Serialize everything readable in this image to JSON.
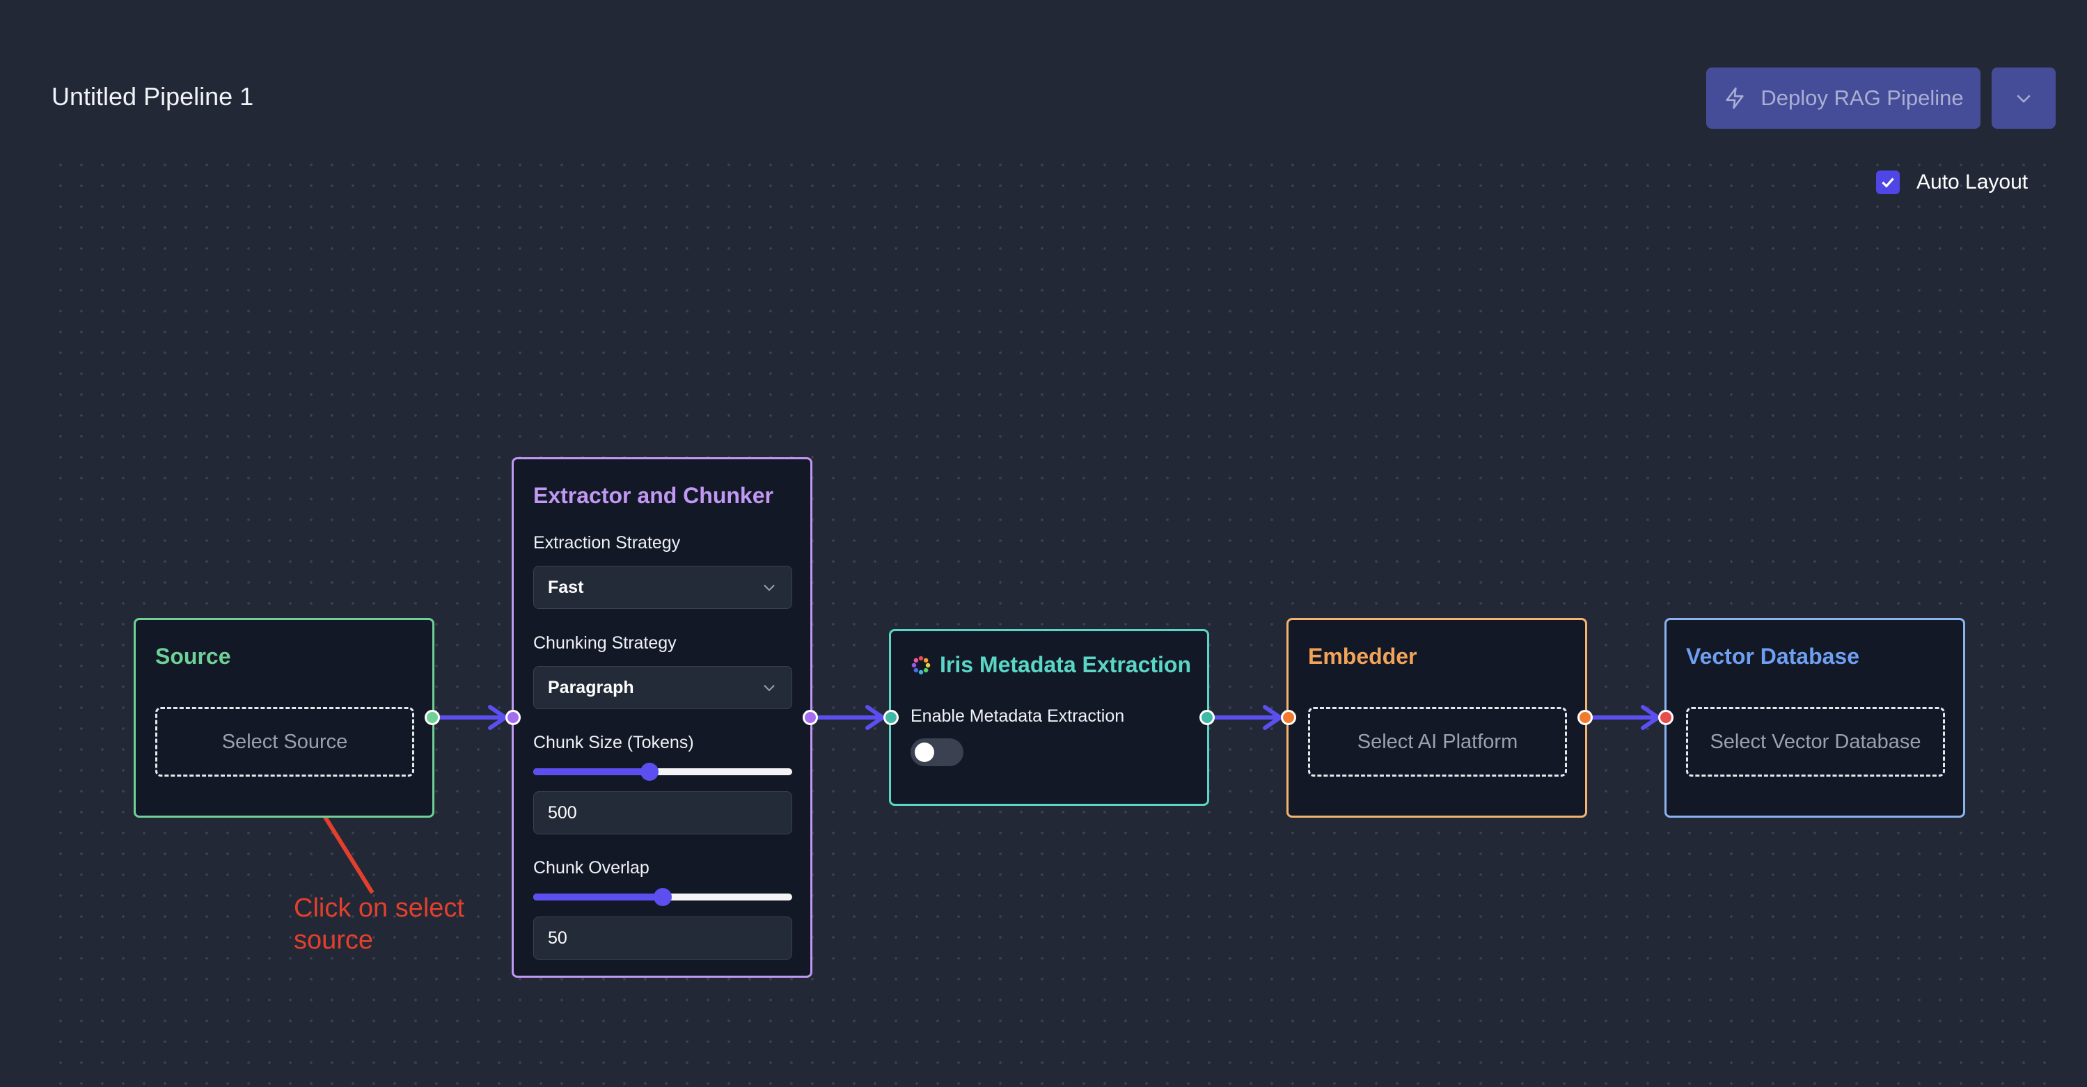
{
  "header": {
    "pipeline_title": "Untitled Pipeline 1",
    "deploy_label": "Deploy RAG Pipeline"
  },
  "auto_layout": {
    "label": "Auto Layout",
    "checked": true
  },
  "nodes": {
    "source": {
      "title": "Source",
      "select_label": "Select Source",
      "color": "#6fd197"
    },
    "extractor": {
      "title": "Extractor and Chunker",
      "color": "#c198f2",
      "extraction_strategy_label": "Extraction Strategy",
      "extraction_strategy_value": "Fast",
      "chunking_strategy_label": "Chunking Strategy",
      "chunking_strategy_value": "Paragraph",
      "chunk_size_label": "Chunk Size (Tokens)",
      "chunk_size_value": "500",
      "chunk_size_slider_fraction": 0.45,
      "chunk_overlap_label": "Chunk Overlap",
      "chunk_overlap_value": "50",
      "chunk_overlap_slider_fraction": 0.5
    },
    "iris": {
      "title": "Iris Metadata Extraction",
      "toggle_label": "Enable Metadata Extraction",
      "enabled": false,
      "color": "#5ad6c6"
    },
    "embedder": {
      "title": "Embedder",
      "select_label": "Select AI Platform",
      "color": "#f2b46e"
    },
    "vector_db": {
      "title": "Vector Database",
      "select_label": "Select Vector Database",
      "color": "#8db3ee"
    }
  },
  "annotation": {
    "text": "Click on select source",
    "color": "#e2402c"
  },
  "colors": {
    "edge": "#5b4ff0",
    "accent": "#4f46e5",
    "background": "#222836",
    "node_background": "#131826"
  }
}
